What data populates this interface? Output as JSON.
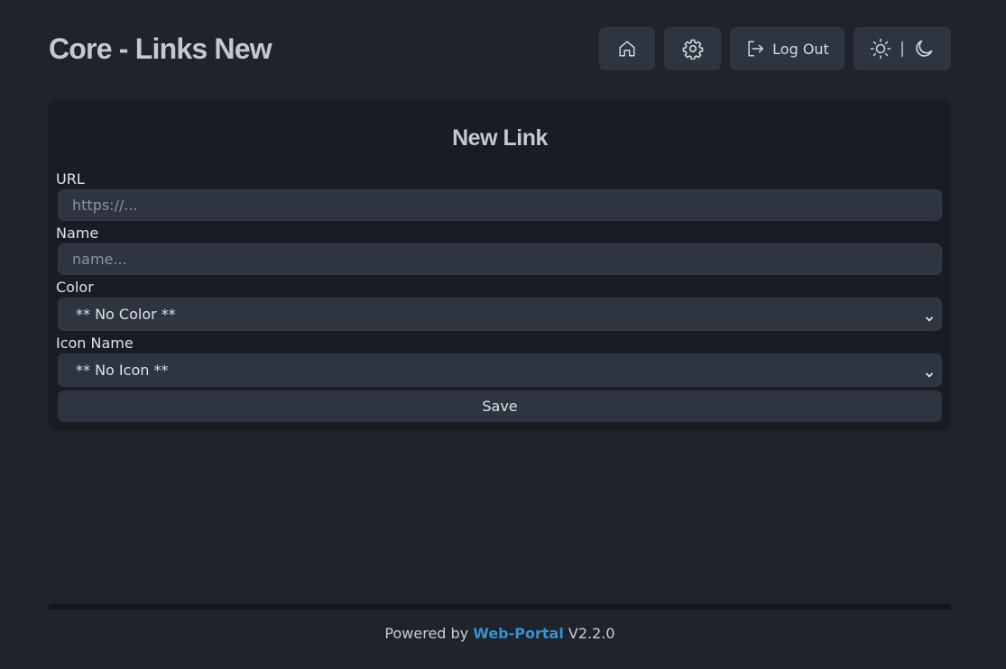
{
  "header": {
    "title": "Core - Links New",
    "nav": {
      "home_icon": "home-icon",
      "settings_icon": "gear-icon",
      "logout_icon": "logout-icon",
      "logout_label": "Log Out",
      "theme_light_icon": "sun-icon",
      "theme_separator": "|",
      "theme_dark_icon": "moon-icon"
    }
  },
  "form": {
    "title": "New Link",
    "url": {
      "label": "URL",
      "placeholder": "https://...",
      "value": ""
    },
    "name": {
      "label": "Name",
      "placeholder": "name...",
      "value": ""
    },
    "color": {
      "label": "Color",
      "selected": "** No Color **"
    },
    "icon": {
      "label": "Icon Name",
      "selected": "** No Icon **"
    },
    "save_label": "Save"
  },
  "footer": {
    "prefix": "Powered by",
    "brand": "Web-Portal",
    "version": "V2.2.0"
  },
  "colors": {
    "background": "#1f232b",
    "card": "#191d23",
    "control": "#2e3540",
    "brand_link": "#3b8fcf"
  }
}
